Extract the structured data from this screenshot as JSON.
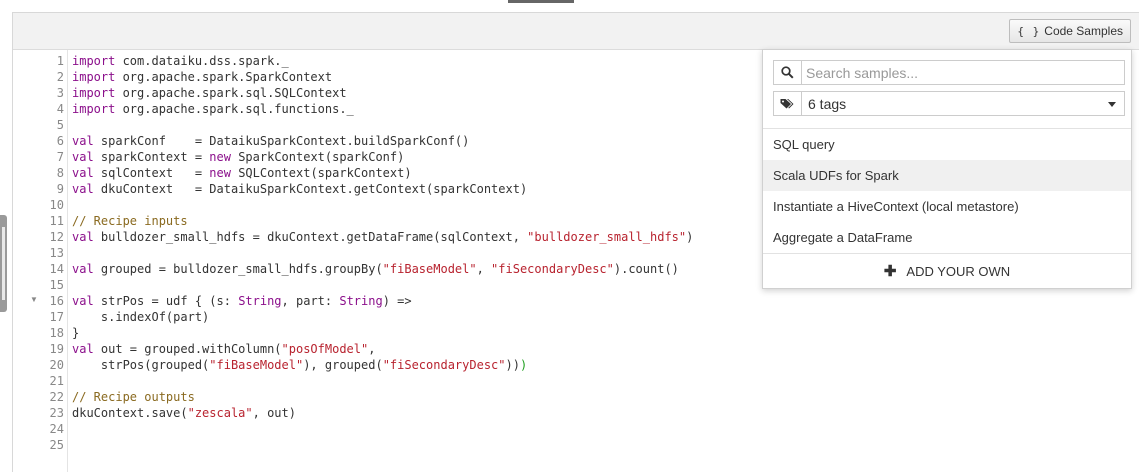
{
  "toolbar": {
    "code_samples_braces": "{ }",
    "code_samples_label": "Code Samples"
  },
  "editor": {
    "line_numbers": [
      "1",
      "2",
      "3",
      "4",
      "5",
      "6",
      "7",
      "8",
      "9",
      "10",
      "11",
      "12",
      "13",
      "14",
      "15",
      "16",
      "17",
      "18",
      "19",
      "20",
      "21",
      "22",
      "23",
      "24",
      "25"
    ],
    "code": {
      "l1_kw": "import",
      "l1_rest": " com.dataiku.dss.spark._",
      "l2_kw": "import",
      "l2_rest": " org.apache.spark.SparkContext",
      "l3_kw": "import",
      "l3_rest": " org.apache.spark.sql.SQLContext",
      "l4_kw": "import",
      "l4_rest": " org.apache.spark.sql.functions._",
      "l6_kw": "val",
      "l6_rest": " sparkConf    = DataikuSparkContext.buildSparkConf()",
      "l7_kw": "val",
      "l7_a": " sparkContext = ",
      "l7_new": "new",
      "l7_b": " SparkContext(sparkConf)",
      "l8_kw": "val",
      "l8_a": " sqlContext   = ",
      "l8_new": "new",
      "l8_b": " SQLContext(sparkContext)",
      "l9_kw": "val",
      "l9_rest": " dkuContext   = DataikuSparkContext.getContext(sparkContext)",
      "l11_com": "// Recipe inputs",
      "l12_kw": "val",
      "l12_a": " bulldozer_small_hdfs = dkuContext.getDataFrame(sqlContext, ",
      "l12_str": "\"bulldozer_small_hdfs\"",
      "l12_b": ")",
      "l14_kw": "val",
      "l14_a": " grouped = bulldozer_small_hdfs.groupBy(",
      "l14_s1": "\"fiBaseModel\"",
      "l14_b": ", ",
      "l14_s2": "\"fiSecondaryDesc\"",
      "l14_c": ").count()",
      "l16_kw": "val",
      "l16_a": " strPos = udf { (s: ",
      "l16_t1": "String",
      "l16_b": ", part: ",
      "l16_t2": "String",
      "l16_c": ") =>",
      "l17": "    s.indexOf(part)",
      "l18": "}",
      "l19_kw": "val",
      "l19_a": " out = grouped.withColumn(",
      "l19_str": "\"posOfModel\"",
      "l19_b": ",",
      "l20_a": "    strPos(grouped(",
      "l20_s1": "\"fiBaseModel\"",
      "l20_b": "), grouped(",
      "l20_s2": "\"fiSecondaryDesc\"",
      "l20_c": "))",
      "l20_d": ")",
      "l22_com": "// Recipe outputs",
      "l23_a": "dkuContext.save(",
      "l23_str": "\"zescala\"",
      "l23_b": ", out)"
    }
  },
  "samples_popup": {
    "search_placeholder": "Search samples...",
    "tags_label": "6 tags",
    "items": [
      "SQL query",
      "Scala UDFs for Spark",
      "Instantiate a HiveContext (local metastore)",
      "Aggregate a DataFrame"
    ],
    "add_your_own": "ADD YOUR OWN"
  },
  "icons": {
    "search": "search-icon",
    "tags": "tags-icon",
    "plus": "plus-icon",
    "caret": "chevron-down-icon",
    "fold": "fold-arrow-icon"
  }
}
